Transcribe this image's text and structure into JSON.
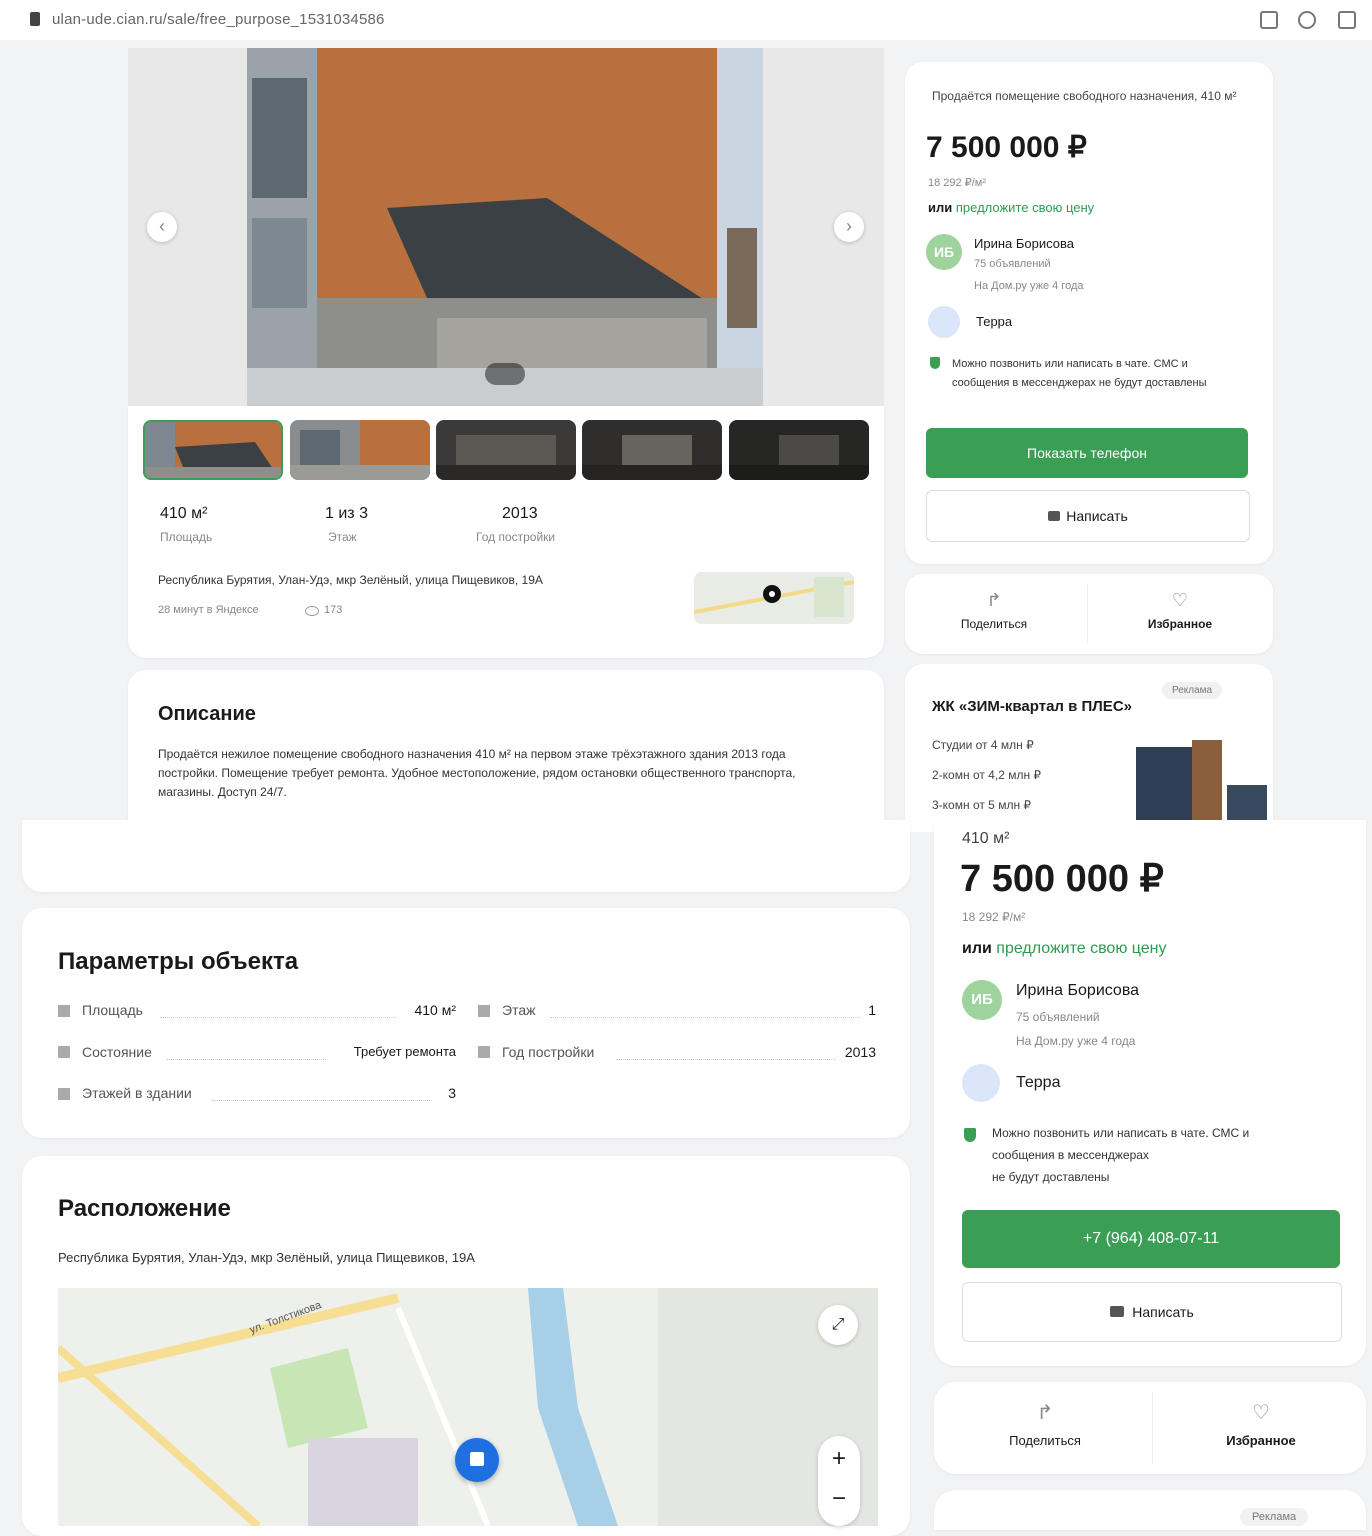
{
  "browser": {
    "url": "ulan-ude.cian.ru/sale/free_purpose_1531034586"
  },
  "gallery": {
    "thumb_count": 5
  },
  "summary": {
    "area_value": "410 м²",
    "area_label": "Площадь",
    "floor_value": "1 из 3",
    "floor_label": "Этаж",
    "year_value": "2013",
    "year_label": "Год постройки",
    "address": "Республика Бурятия, Улан-Удэ, мкр Зелёный, улица Пищевиков, 19А",
    "published": "28 минут в Яндексе",
    "views": "173"
  },
  "description": {
    "title": "Описание",
    "text": "Продаётся нежилое помещение свободного назначения 410 м² на первом этаже трёхэтажного здания 2013 года постройки. Помещение требует ремонта. Удобное местоположение, рядом остановки общественного транспорта, магазины. Доступ 24/7."
  },
  "seller_top": {
    "object_title": "Продаётся помещение свободного назначения, 410 м²",
    "price": "7 500 000 ₽",
    "price_per_m": "18 292 ₽/м²",
    "offer_prefix": "или",
    "offer_link": "предложите свою цену",
    "agent_initials": "ИБ",
    "agent_name": "Ирина Борисова",
    "agent_objects": "75 объявлений",
    "agent_since": "На Дом.ру уже 4 года",
    "agency_name": "Терра",
    "notice": "Можно позвонить или написать в чате. СМС и сообщения в мессенджерах не будут доставлены",
    "phone_button": "Показать телефон",
    "write_button": "Написать",
    "share": "Поделиться",
    "favorite": "Избранное"
  },
  "promo": {
    "title": "ЖК «ЗИМ-квартал в ПЛЕС»",
    "badge": "Реклама",
    "line1": "Студии от 4 млн ₽",
    "line2": "2-комн от 4,2 млн ₽",
    "line3": "3-комн от 5 млн ₽"
  },
  "params": {
    "title": "Параметры объекта",
    "rows": [
      {
        "label": "Площадь",
        "value": "410 м²"
      },
      {
        "label": "Этаж",
        "value": "1"
      },
      {
        "label": "Состояние",
        "value": "Требует ремонта"
      },
      {
        "label": "Год постройки",
        "value": "2013"
      },
      {
        "label": "Этажей в здании",
        "value": "3"
      }
    ]
  },
  "location": {
    "title": "Расположение",
    "address": "Республика Бурятия, Улан-Удэ, мкр Зелёный, улица Пищевиков, 19А",
    "street_label": "ул. Толстикова",
    "zoom_in": "+",
    "zoom_out": "−"
  },
  "seller_bottom": {
    "area_line": "410 м²",
    "price": "7 500 000 ₽",
    "price_per_m": "18 292 ₽/м²",
    "offer_prefix": "или",
    "offer_link": "предложите свою цену",
    "agent_initials": "ИБ",
    "agent_name": "Ирина Борисова",
    "agent_objects": "75 объявлений",
    "agent_since": "На Дом.ру уже 4 года",
    "agency_name": "Терра",
    "notice_1": "Можно позвонить или написать в чате. СМС и",
    "notice_2": "сообщения в мессенджерах",
    "notice_3": "не будут доставлены",
    "phone_button": "+7 (964) 408-07-11",
    "write_button": "Написать",
    "share": "Поделиться",
    "favorite": "Избранное",
    "ad_badge": "Реклама"
  },
  "colors": {
    "accent": "#3a9f55",
    "map_marker": "#1e6fe0",
    "link": "#2e9b4e"
  }
}
